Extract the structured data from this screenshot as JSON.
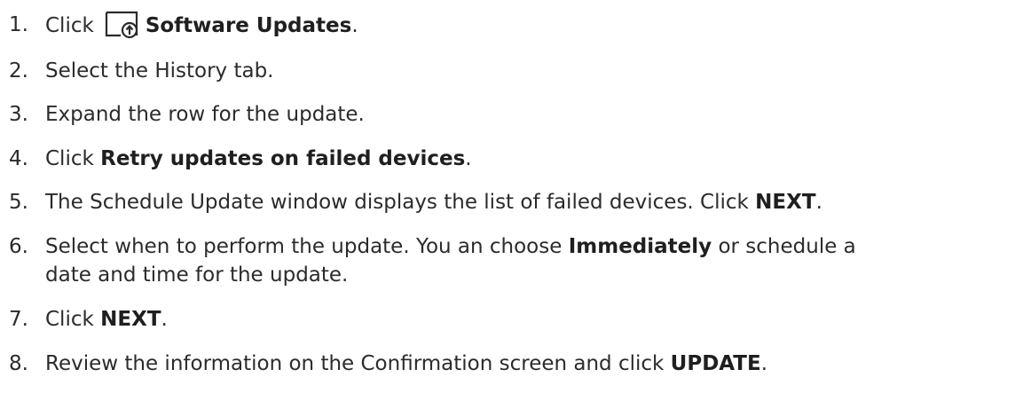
{
  "steps": [
    {
      "number": "1.",
      "prefix": "Click",
      "icon": "software-updates-icon",
      "bold": "Software Updates",
      "suffix": "."
    },
    {
      "number": "2.",
      "text": "Select the History tab."
    },
    {
      "number": "3.",
      "text": "Expand the row for the update."
    },
    {
      "number": "4.",
      "prefix": "Click",
      "bold": "Retry updates on failed devices",
      "suffix": "."
    },
    {
      "number": "5.",
      "prefix": "The Schedule Update window displays the list of failed devices. Click",
      "bold": "NEXT",
      "suffix": "."
    },
    {
      "number": "6.",
      "prefix": "Select when to perform the update. You an choose",
      "bold": "Immediately",
      "suffix": "or schedule a",
      "line2": "date and time for the update."
    },
    {
      "number": "7.",
      "prefix": "Click",
      "bold": "NEXT",
      "suffix": "."
    },
    {
      "number": "8.",
      "prefix": "Review the information on the Confirmation screen and click",
      "bold": "UPDATE",
      "suffix": "."
    }
  ]
}
